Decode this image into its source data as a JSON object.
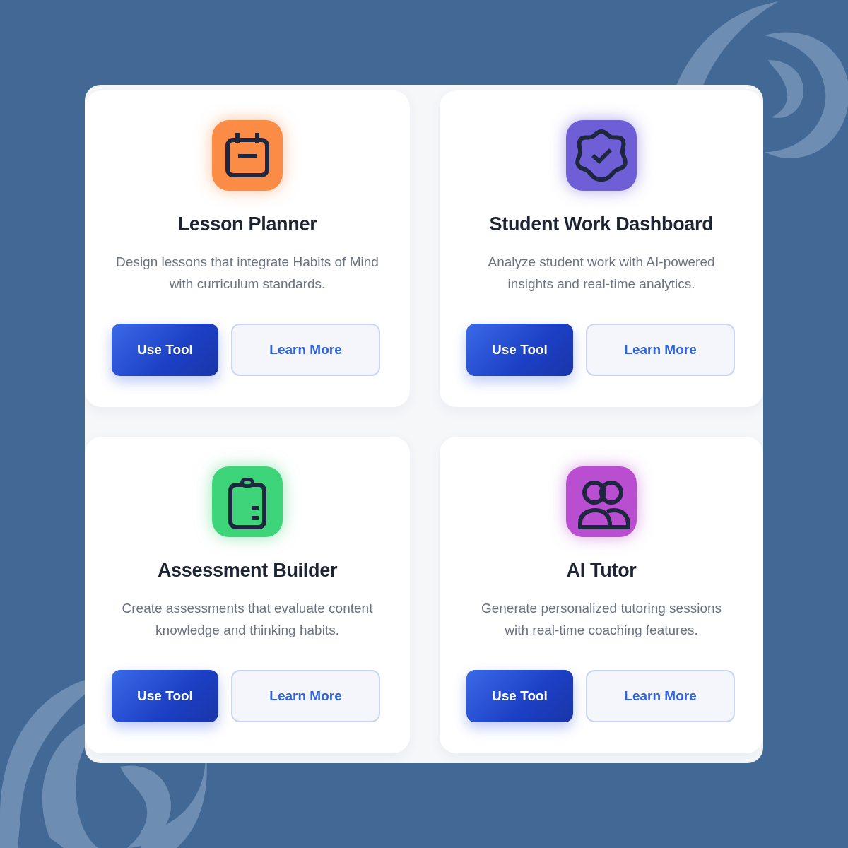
{
  "tools": [
    {
      "title": "Lesson Planner",
      "description": "Design lessons that integrate Habits of Mind with curriculum standards.",
      "color": "#fb8c46",
      "buttons": [
        "Use Tool",
        "Learn More"
      ]
    },
    {
      "title": "Student Work Dashboard",
      "description": "Analyze student work with AI-powered insights and real-time analytics.",
      "color": "#6e5fd6",
      "buttons": [
        "Use Tool",
        "Learn More"
      ]
    },
    {
      "title": "Assessment Builder",
      "description": "Create assessments that evaluate content knowledge and thinking habits.",
      "color": "#3ed47a",
      "buttons": [
        "Use Tool",
        "Learn More"
      ]
    },
    {
      "title": "AI Tutor",
      "description": "Generate personalized tutoring sessions with real-time coaching features.",
      "color": "#b94fd0",
      "buttons": [
        "Use Tool",
        "Learn More"
      ]
    }
  ]
}
